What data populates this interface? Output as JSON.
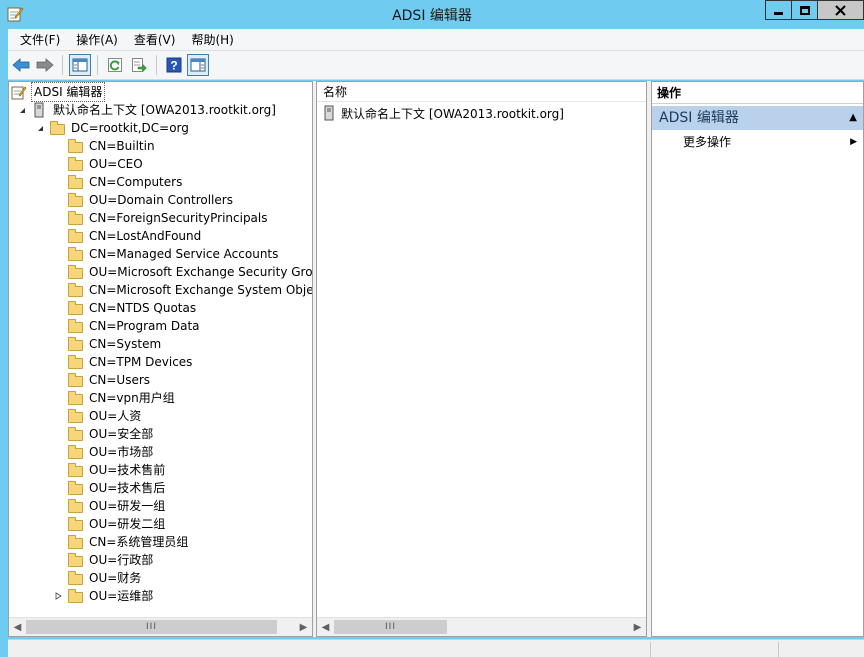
{
  "window": {
    "title": "ADSI 编辑器",
    "minimize_icon": "minimize-icon",
    "maximize_icon": "maximize-icon",
    "close_icon": "close-icon"
  },
  "menu": [
    "文件(F)",
    "操作(A)",
    "查看(V)",
    "帮助(H)"
  ],
  "toolbar": {
    "icons": [
      "back-icon",
      "forward-icon",
      "show-hide-console-tree-icon",
      "refresh-icon",
      "export-list-icon",
      "help-icon",
      "show-hide-action-pane-icon"
    ]
  },
  "tree": {
    "root": "ADSI 编辑器",
    "context": "默认命名上下文 [OWA2013.rootkit.org]",
    "domain": "DC=rootkit,DC=org",
    "children": [
      "CN=Builtin",
      "OU=CEO",
      "CN=Computers",
      "OU=Domain Controllers",
      "CN=ForeignSecurityPrincipals",
      "CN=LostAndFound",
      "CN=Managed Service Accounts",
      "OU=Microsoft Exchange Security Grou",
      "CN=Microsoft Exchange System Objec",
      "CN=NTDS Quotas",
      "CN=Program Data",
      "CN=System",
      "CN=TPM Devices",
      "CN=Users",
      "CN=vpn用户组",
      "OU=人资",
      "OU=安全部",
      "OU=市场部",
      "OU=技术售前",
      "OU=技术售后",
      "OU=研发一组",
      "OU=研发二组",
      "CN=系统管理员组",
      "OU=行政部",
      "OU=财务",
      "OU=运维部"
    ]
  },
  "list": {
    "column_header": "名称",
    "rows": [
      "默认命名上下文 [OWA2013.rootkit.org]"
    ]
  },
  "actions": {
    "header": "操作",
    "group": "ADSI 编辑器",
    "item": "更多操作"
  },
  "scrollbar": {
    "thumb_label": "III"
  },
  "colors": {
    "titlebar": "#6fcbef",
    "action_group": "#b9d1ea",
    "folder": "#f7d67a"
  }
}
